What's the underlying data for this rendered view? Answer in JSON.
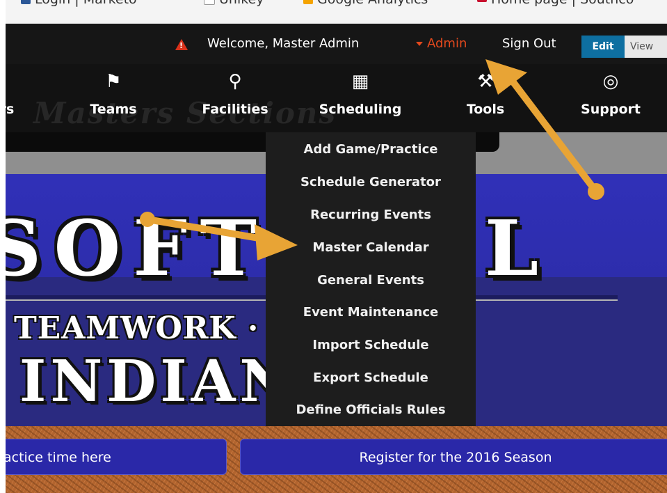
{
  "bookmarks": [
    {
      "label": "Login | Marketo",
      "icon": "bar-chart-icon",
      "color": "#2b5797"
    },
    {
      "label": "Unikey",
      "icon": "page-icon",
      "color": "#9a9a9a"
    },
    {
      "label": "Google Analytics",
      "icon": "analytics-icon",
      "color": "#f4a300"
    },
    {
      "label": "Home page | Southco",
      "icon": "southco-icon",
      "color": "#c8102e"
    }
  ],
  "topbar": {
    "welcome": "Welcome, Master Admin",
    "admin_label": "Admin",
    "signout_label": "Sign Out",
    "edit_label": "Edit",
    "view_label": "View"
  },
  "nav": {
    "items": [
      {
        "label": "rs",
        "icon": ""
      },
      {
        "label": "Teams",
        "icon": "flag-icon"
      },
      {
        "label": "Facilities",
        "icon": "map-pin-icon"
      },
      {
        "label": "Scheduling",
        "icon": "calendar-icon"
      },
      {
        "label": "Tools",
        "icon": "wrench-icon"
      },
      {
        "label": "Support",
        "icon": "lifebuoy-icon"
      }
    ],
    "ghost_text": "Masters Sections"
  },
  "dropdown": {
    "items": [
      "Add Game/Practice",
      "Schedule Generator",
      "Recurring Events",
      "Master Calendar",
      "General Events",
      "Event Maintenance",
      "Import Schedule",
      "Export Schedule",
      "Define Officials Rules"
    ]
  },
  "banner": {
    "big_word": "SOFTBALL",
    "motto": "TEAMWORK · HONOR",
    "team_word": "INDIANS"
  },
  "buttons": {
    "practice_label": "actice time here",
    "register_label": "Register for the 2016 Season"
  },
  "colors": {
    "admin_accent": "#e4491d",
    "edit_blue": "#0e6fa1",
    "banner_blue": "#3030b8",
    "arrow": "#e8a435"
  }
}
